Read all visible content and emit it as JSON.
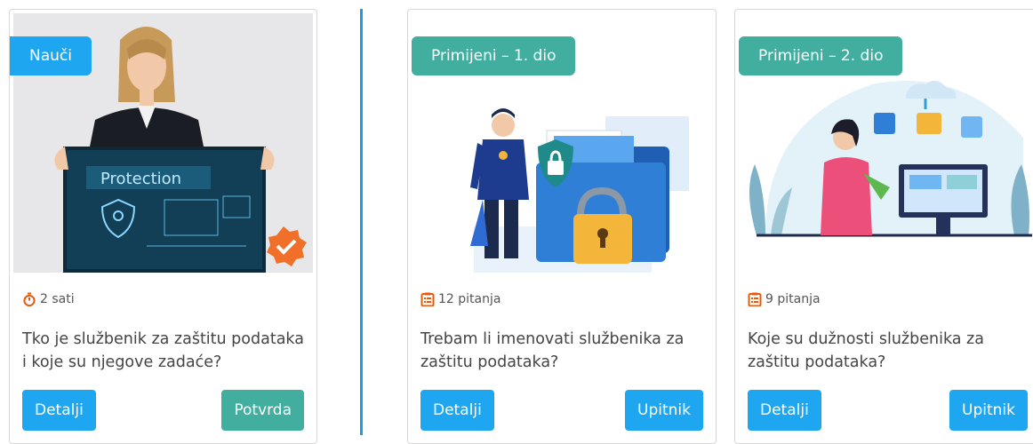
{
  "cards": [
    {
      "badge": "Nauči",
      "meta": "2 sati",
      "meta_icon": "stopwatch-icon",
      "title": "Tko je službenik za zaštitu podataka i koje su njegove zadaće?",
      "left_button": "Detalji",
      "right_button": "Potvrda",
      "image_text": "Protection"
    },
    {
      "badge": "Primijeni – 1. dio",
      "meta": "12 pitanja",
      "meta_icon": "clipboard-list-icon",
      "title": "Trebam li imenovati službenika za zaštitu podataka?",
      "left_button": "Detalji",
      "right_button": "Upitnik"
    },
    {
      "badge": "Primijeni – 2. dio",
      "meta": "9 pitanja",
      "meta_icon": "clipboard-list-icon",
      "title": "Koje su dužnosti službenika za zaštitu podataka?",
      "left_button": "Detalji",
      "right_button": "Upitnik"
    }
  ],
  "colors": {
    "accent_blue": "#1ea7f0",
    "accent_teal": "#41aea0",
    "divider": "#1a9de8",
    "meta_icon": "#e8590c"
  }
}
